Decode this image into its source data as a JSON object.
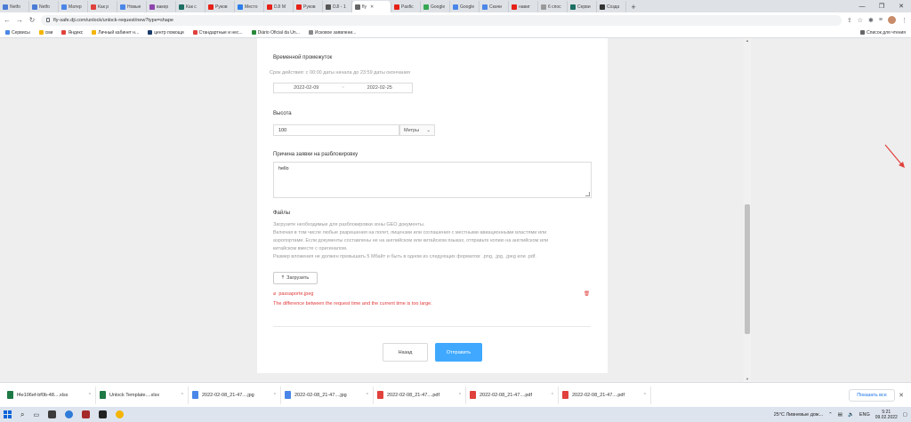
{
  "browser": {
    "tabs": [
      {
        "label": "Netfo",
        "color": "#4a7bd6",
        "active": false
      },
      {
        "label": "Netfo",
        "color": "#4a7bd6",
        "active": false
      },
      {
        "label": "Матер",
        "color": "#4a86e8",
        "active": false
      },
      {
        "label": "Как р",
        "color": "#e0413c",
        "active": false
      },
      {
        "label": "Новые",
        "color": "#4a86e8",
        "active": false
      },
      {
        "label": "вакер",
        "color": "#8e44ad",
        "active": false
      },
      {
        "label": "Как с",
        "color": "#1b6f63",
        "active": false
      },
      {
        "label": "Руков",
        "color": "#e62117",
        "active": false
      },
      {
        "label": "Место",
        "color": "#2b7de9",
        "active": false
      },
      {
        "label": "DJI М",
        "color": "#e62117",
        "active": false
      },
      {
        "label": "Руков",
        "color": "#e62117",
        "active": false
      },
      {
        "label": "DJI - 1",
        "color": "#555555",
        "active": false
      },
      {
        "label": "fly",
        "color": "#666666",
        "active": true
      },
      {
        "label": "Pasfic",
        "color": "#e62117",
        "active": false
      },
      {
        "label": "Google",
        "color": "#34a853",
        "active": false
      },
      {
        "label": "Google",
        "color": "#4a86e8",
        "active": false
      },
      {
        "label": "Скачи",
        "color": "#4a86e8",
        "active": false
      },
      {
        "label": "навиг",
        "color": "#e62117",
        "active": false
      },
      {
        "label": "6 спос",
        "color": "#999999",
        "active": false
      },
      {
        "label": "Серви",
        "color": "#1b6f63",
        "active": false
      },
      {
        "label": "Созда",
        "color": "#333333",
        "active": false
      }
    ],
    "url": "fly-safe.dji.com/unlock/unlock-request/new?type=shape",
    "bookmarks": [
      {
        "label": "Сервисы",
        "color": "#4a86e8"
      },
      {
        "label": "сми",
        "color": "#f4b400"
      },
      {
        "label": "Яндекс",
        "color": "#e0413c"
      },
      {
        "label": "Личный кабинет н...",
        "color": "#f4b400"
      },
      {
        "label": "центр помощи",
        "color": "#1a3a6b"
      },
      {
        "label": "Стандартные и нес...",
        "color": "#e0413c"
      },
      {
        "label": "Diário Oficial da Un...",
        "color": "#2a8a3a"
      },
      {
        "label": "Исковое заявлени...",
        "color": "#888888"
      }
    ],
    "reading_list": "Список для чтения"
  },
  "form": {
    "time_label": "Временной промежуток",
    "time_hint": "Срок действия: с 00:00 даты начала до 23:59 даты окончания",
    "date_start": "2022-02-09",
    "date_sep": "~",
    "date_end": "2022-02-25",
    "height_label": "Высота",
    "height_value": "100",
    "unit": "Метры",
    "reason_label": "Причина заявки на разблокировку",
    "reason_value": "hello",
    "files_label": "Файлы",
    "files_hint_lines": [
      "Загрузите необходимые для разблокировки зоны GEO документы.",
      "Включая в том числе любые разрешения на полет, лицензии или соглашения с местными авиационными властями или",
      "аэропортами. Если документы составлены не на английском или китайском языках, отправьте копию на английском или",
      "китайском вместе с оригиналом.",
      "Размер вложения не должен превышать 5 Мбайт и быть в одном из следующих форматов: .png, .jpg, .jpeg или .pdf."
    ],
    "upload_label": "Загрузить",
    "file_name": "passaporte.jpeg",
    "error_text": "The difference between the request time and the current time is too large.",
    "back_label": "Назад",
    "submit_label": "Отправить"
  },
  "downloads": {
    "items": [
      {
        "name": "f4e106ef-bf0b-48....xlsx",
        "color": "#1d7a45"
      },
      {
        "name": "Unlock Template....xlsx",
        "color": "#1d7a45"
      },
      {
        "name": "2022-02-08_21-47....jpg",
        "color": "#4a86e8"
      },
      {
        "name": "2022-02-08_21-47....jpg",
        "color": "#4a86e8"
      },
      {
        "name": "2022-02-08_21-47....pdf",
        "color": "#e0413c"
      },
      {
        "name": "2022-02-08_21-47....pdf",
        "color": "#e0413c"
      },
      {
        "name": "2022-02-08_21-47....pdf",
        "color": "#e0413c"
      }
    ],
    "show_all": "Показать все"
  },
  "taskbar": {
    "weather": "25°C  Ливневые дож...",
    "lang": "ENG",
    "time": "5:21",
    "date": "09.02.2022"
  },
  "colors": {
    "accent": "#40a9ff",
    "error": "#e03b3b"
  }
}
